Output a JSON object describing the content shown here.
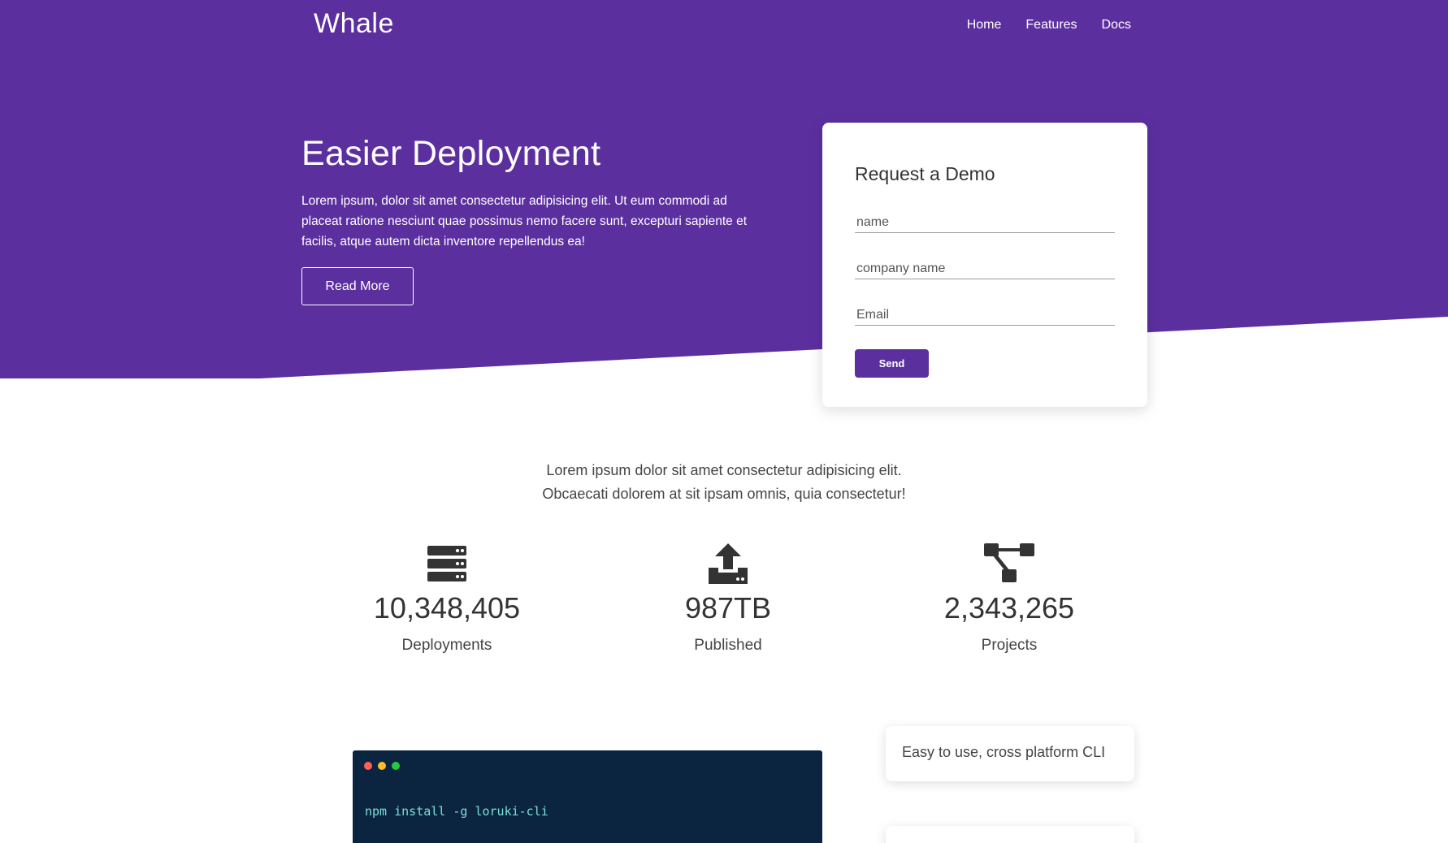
{
  "colors": {
    "brand_purple": "#5c2f9f",
    "terminal_bg": "#0b2540",
    "terminal_text": "#7fe0d8",
    "dot_red": "#ff5f56",
    "dot_yellow": "#ffbd2e",
    "dot_green": "#27c93f"
  },
  "nav": {
    "brand": "Whale",
    "links": [
      "Home",
      "Features",
      "Docs"
    ]
  },
  "hero": {
    "title": "Easier Deployment",
    "text": "Lorem ipsum, dolor sit amet consectetur adipisicing elit. Ut eum commodi ad placeat ratione nesciunt quae possimus nemo facere sunt, excepturi sapiente et facilis, atque autem dicta inventore repellendus ea!",
    "button": "Read More"
  },
  "demo_form": {
    "title": "Request a Demo",
    "fields": [
      {
        "placeholder": "name",
        "value": ""
      },
      {
        "placeholder": "company name",
        "value": ""
      },
      {
        "placeholder": "Email",
        "value": ""
      }
    ],
    "submit": "Send"
  },
  "intro": {
    "line1": "Lorem ipsum dolor sit amet consectetur adipisicing elit.",
    "line2": "Obcaecati dolorem at sit ipsam omnis, quia consectetur!"
  },
  "stats": [
    {
      "icon": "server-icon",
      "value": "10,348,405",
      "label": "Deployments"
    },
    {
      "icon": "upload-icon",
      "value": "987TB",
      "label": "Published"
    },
    {
      "icon": "project-diagram-icon",
      "value": "2,343,265",
      "label": "Projects"
    }
  ],
  "terminal": {
    "command": "npm install -g loruki-cli"
  },
  "features": [
    {
      "text": "Easy to use, cross platform CLI"
    },
    {
      "text": ""
    }
  ]
}
